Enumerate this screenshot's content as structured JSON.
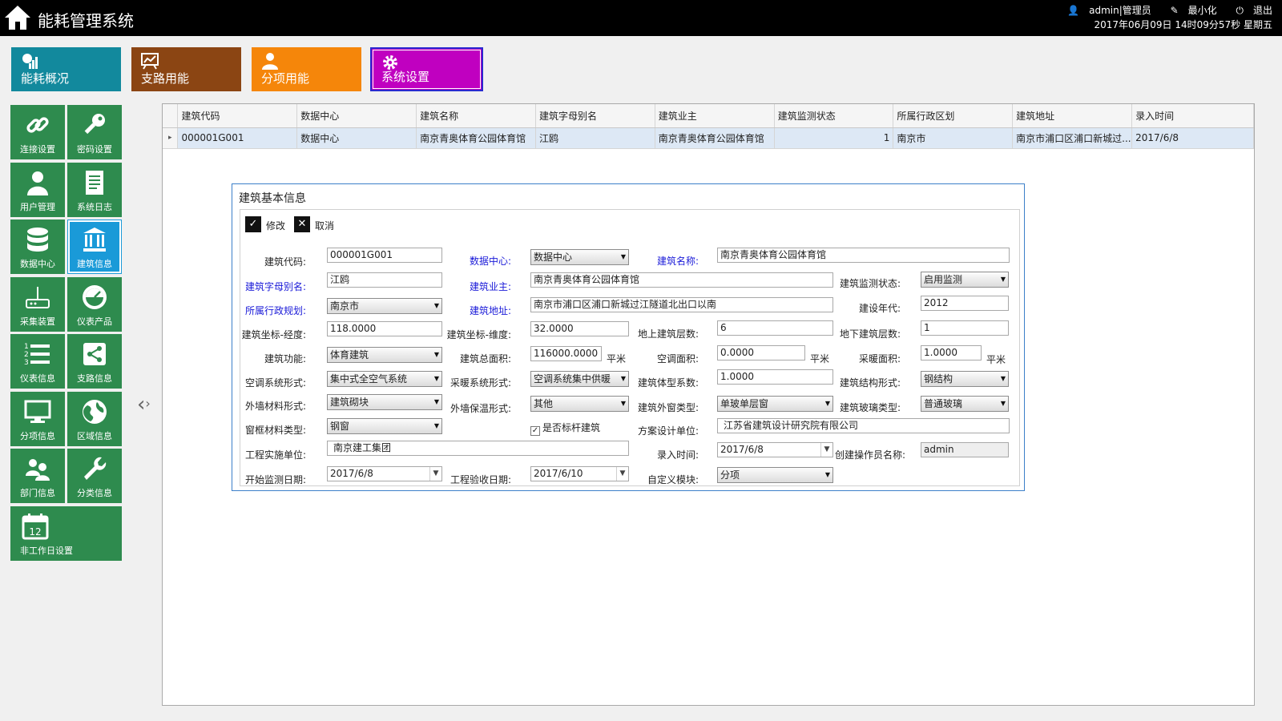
{
  "app": {
    "title": "能耗管理系统",
    "user": "admin|管理员",
    "minimize": "最小化",
    "exit": "退出",
    "datetime": "2017年06月09日 14时09分57秒 星期五"
  },
  "module_tabs": [
    {
      "label": "能耗概况",
      "color": "#12899d"
    },
    {
      "label": "支路用能",
      "color": "#8b4513"
    },
    {
      "label": "分项用能",
      "color": "#f5860a"
    },
    {
      "label": "系统设置",
      "color": "#c000c0"
    }
  ],
  "sidebar": [
    {
      "label": "连接设置",
      "icon": "link-icon"
    },
    {
      "label": "密码设置",
      "icon": "key-icon"
    },
    {
      "label": "用户管理",
      "icon": "user-icon"
    },
    {
      "label": "系统日志",
      "icon": "log-icon"
    },
    {
      "label": "数据中心",
      "icon": "database-icon"
    },
    {
      "label": "建筑信息",
      "icon": "building-icon",
      "active": true
    },
    {
      "label": "采集装置",
      "icon": "router-icon"
    },
    {
      "label": "仪表产品",
      "icon": "gauge-icon"
    },
    {
      "label": "仪表信息",
      "icon": "list-icon"
    },
    {
      "label": "支路信息",
      "icon": "share-icon"
    },
    {
      "label": "分项信息",
      "icon": "monitor-icon"
    },
    {
      "label": "区域信息",
      "icon": "globe-icon"
    },
    {
      "label": "部门信息",
      "icon": "group-icon"
    },
    {
      "label": "分类信息",
      "icon": "wrench-icon"
    },
    {
      "label": "非工作日设置",
      "icon": "calendar-icon",
      "badge": "12"
    }
  ],
  "grid": {
    "columns": [
      "建筑代码",
      "数据中心",
      "建筑名称",
      "建筑字母别名",
      "建筑业主",
      "建筑监测状态",
      "所属行政区划",
      "建筑地址",
      "录入时间"
    ],
    "rows": [
      [
        "000001G001",
        "数据中心",
        "南京青奥体育公园体育馆",
        "江鸥",
        "南京青奥体育公园体育馆",
        "1",
        "南京市",
        "南京市浦口区浦口新城过...",
        "2017/6/8"
      ]
    ]
  },
  "dialog": {
    "title": "建筑基本信息",
    "edit_label": "修改",
    "cancel_label": "取消",
    "labels": {
      "code": "建筑代码:",
      "datacenter": "数据中心:",
      "name": "建筑名称:",
      "alias": "建筑字母别名:",
      "owner": "建筑业主:",
      "monitor_status": "建筑监测状态:",
      "region": "所属行政规划:",
      "address": "建筑地址:",
      "build_year": "建设年代:",
      "longitude": "建筑坐标-经度:",
      "latitude": "建筑坐标-维度:",
      "floors_above": "地上建筑层数:",
      "floors_below": "地下建筑层数:",
      "function": "建筑功能:",
      "total_area": "建筑总面积:",
      "ac_area": "空调面积:",
      "heating_area": "采暖面积:",
      "ac_system": "空调系统形式:",
      "heating_system": "采暖系统形式:",
      "shape_coef": "建筑体型系数:",
      "structure": "建筑结构形式:",
      "wall_material": "外墙材料形式:",
      "wall_insulation": "外墙保温形式:",
      "window_type": "建筑外窗类型:",
      "glass_type": "建筑玻璃类型:",
      "frame_material": "窗框材料类型:",
      "benchmark": "是否标杆建筑",
      "design_unit": "方案设计单位:",
      "construction_unit": "工程实施单位:",
      "entry_time": "录入时间:",
      "operator": "创建操作员名称:",
      "monitor_start": "开始监测日期:",
      "acceptance_date": "工程验收日期:",
      "custom_module": "自定义模块:"
    },
    "values": {
      "code": "000001G001",
      "datacenter": "数据中心",
      "name": "南京青奥体育公园体育馆",
      "alias": "江鸥",
      "owner": "南京青奥体育公园体育馆",
      "monitor_status": "启用监测",
      "region": "南京市",
      "address": "南京市浦口区浦口新城过江隧道北出口以南",
      "build_year": "2012",
      "longitude": "118.0000",
      "latitude": "32.0000",
      "floors_above": "6",
      "floors_below": "1",
      "function": "体育建筑",
      "total_area": "116000.0000",
      "ac_area": "0.0000",
      "heating_area": "1.0000",
      "ac_system": "集中式全空气系统",
      "heating_system": "空调系统集中供暖",
      "shape_coef": "1.0000",
      "structure": "钢结构",
      "wall_material": "建筑砌块",
      "wall_insulation": "其他",
      "window_type": "单玻单层窗",
      "glass_type": "普通玻璃",
      "frame_material": "钢窗",
      "benchmark_checked": true,
      "design_unit": "江苏省建筑设计研究院有限公司",
      "construction_unit": "南京建工集团",
      "entry_time": "2017/6/8",
      "operator": "admin",
      "monitor_start": "2017/6/8",
      "acceptance_date": "2017/6/10",
      "custom_module": "分项"
    },
    "unit": "平米"
  }
}
